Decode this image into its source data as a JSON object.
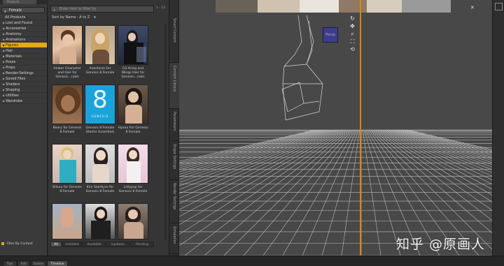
{
  "left_panel": {
    "top_tab_label": "Products",
    "category_dropdown": "Female",
    "categories": [
      {
        "label": "All Products",
        "arrow": false,
        "selected": false
      },
      {
        "label": "Lost and Found",
        "arrow": true,
        "selected": false
      },
      {
        "label": "Accessories",
        "arrow": true,
        "selected": false
      },
      {
        "label": "Anatomy",
        "arrow": true,
        "selected": false
      },
      {
        "label": "Animations",
        "arrow": true,
        "selected": false
      },
      {
        "label": "Figures",
        "arrow": true,
        "selected": true
      },
      {
        "label": "Hair",
        "arrow": true,
        "selected": false
      },
      {
        "label": "Materials",
        "arrow": true,
        "selected": false
      },
      {
        "label": "Poses",
        "arrow": true,
        "selected": false
      },
      {
        "label": "Props",
        "arrow": true,
        "selected": false
      },
      {
        "label": "Render-Settings",
        "arrow": true,
        "selected": false
      },
      {
        "label": "Saved Files",
        "arrow": true,
        "selected": false
      },
      {
        "label": "Shaders",
        "arrow": true,
        "selected": false
      },
      {
        "label": "Shaping",
        "arrow": true,
        "selected": false
      },
      {
        "label": "Utilities",
        "arrow": true,
        "selected": false
      },
      {
        "label": "Wardrobe",
        "arrow": true,
        "selected": false
      }
    ],
    "filter_label": "Filter By Context",
    "accent_color": "#e6a818"
  },
  "content_library": {
    "search_placeholder": "Enter text to filter by",
    "page_indicator": "1 - 12",
    "sort_label": "Sort by Name : A to Z",
    "products": [
      {
        "caption": "Amber Character and Hair for Genesis...(ale)"
      },
      {
        "caption": "Anastasia For Genesis 8 Female"
      },
      {
        "caption": "CG Krieg and Wings Hair for Genesis...(ale)"
      },
      {
        "caption": "Beary for Genesis 8 Female"
      },
      {
        "caption": "Genesis 8 Female Starter Essentials"
      },
      {
        "caption": "Hyona For Genesis 8 Female"
      },
      {
        "caption": "Kitsou for Genesis 8 Female"
      },
      {
        "caption": "Kim SeaHyun for Genesis 8 Female"
      },
      {
        "caption": "Lollypop for Genesis 8 Female"
      },
      {
        "caption": ""
      },
      {
        "caption": ""
      },
      {
        "caption": ""
      }
    ],
    "genesis_logo_number": "8",
    "genesis_logo_text": "GENESIS",
    "bottom_tabs": [
      "All",
      "Installed",
      "Available",
      "Updates",
      "Pending"
    ]
  },
  "side_tabs": [
    "Smart Content",
    "Content Library",
    "Parameters",
    "Shape Settings",
    "Render Settings",
    "Simulation"
  ],
  "viewport": {
    "projection_label": "Persp",
    "tool_icons": [
      "rotate-icon",
      "pan-icon",
      "zoom-icon",
      "frame-icon",
      "reset-icon"
    ],
    "divider_color": "#c98c1a"
  },
  "bottom_bar": {
    "tabs": [
      "Tips",
      "Info",
      "Scene",
      "Timeline"
    ],
    "selected_tab": "Timeline"
  },
  "watermark": "知乎 @原画人"
}
